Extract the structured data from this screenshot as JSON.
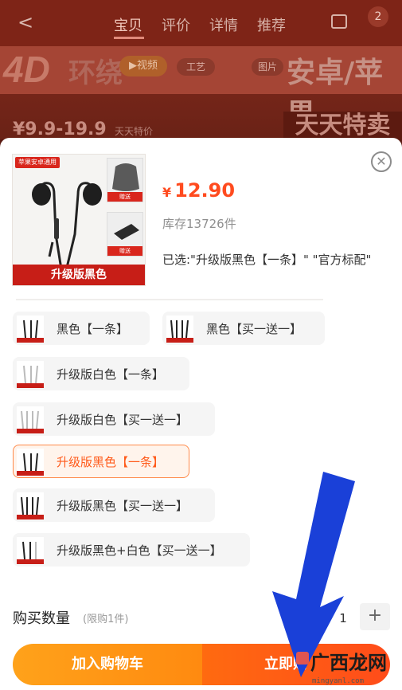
{
  "background": {
    "nav": {
      "back": "<",
      "tabs": [
        "宝贝",
        "评价",
        "详情",
        "推荐"
      ],
      "badge": "2"
    },
    "banner": {
      "big": "4D",
      "title": "环绕",
      "video_label": "▶视频",
      "craft_label": "工艺",
      "pic_label": "图片",
      "platform": "安卓/苹果",
      "price_range": "¥9.9-19.9",
      "sale_text": "天天特价",
      "promo": "天天特卖"
    }
  },
  "sheet": {
    "thumbnail": {
      "tag": "苹果安卓通用",
      "caption": "升级版黑色",
      "sub1": "赠送",
      "sub2": "赠送"
    },
    "price": {
      "currency": "¥",
      "value": "12.90"
    },
    "stock": "库存13726件",
    "selected": "已选:\"升级版黑色【一条】\" \"官方标配\"",
    "options": [
      {
        "label": "黑色【一条】",
        "selected": false
      },
      {
        "label": "黑色【买一送一】",
        "selected": false
      },
      {
        "label": "升级版白色【一条】",
        "selected": false
      },
      {
        "label": "升级版白色【买一送一】",
        "selected": false
      },
      {
        "label": "升级版黑色【一条】",
        "selected": true
      },
      {
        "label": "升级版黑色【买一送一】",
        "selected": false
      },
      {
        "label": "升级版黑色+白色【买一送一】",
        "selected": false
      }
    ],
    "quantity": {
      "label": "购买数量",
      "limit": "(限购1件)",
      "value": "1",
      "plus": "+"
    },
    "buttons": {
      "add_to_cart": "加入购物车",
      "buy_now": "立即购"
    }
  },
  "watermark": {
    "text": "广西龙网",
    "url": "mingyanl.com"
  },
  "colors": {
    "accent": "#ff4b1f",
    "cart_button": "#ff9a16",
    "arrow": "#1a40d8"
  }
}
